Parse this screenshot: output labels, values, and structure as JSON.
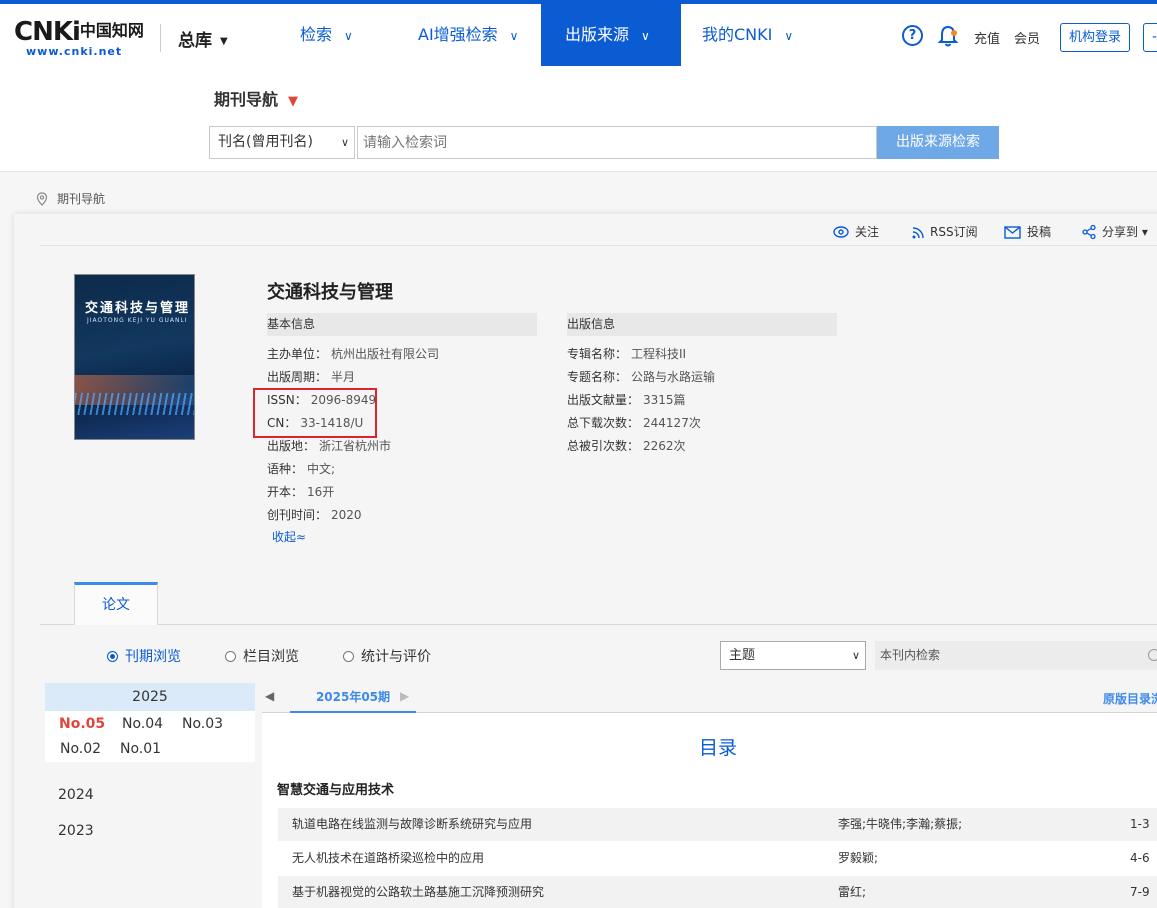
{
  "colors": {
    "brand": "#0b5bd3",
    "accent_red": "#e0473b",
    "search_btn": "#6fa8e6",
    "highlight_box": "#d9252b"
  },
  "header": {
    "logo_text": "CNKi",
    "logo_cn": "中国知网",
    "logo_url_text": "www.cnki.net",
    "database_select": "总库",
    "nav": [
      {
        "label": "检索",
        "active": false
      },
      {
        "label": "AI增强检索",
        "active": false
      },
      {
        "label": "出版来源",
        "active": true
      },
      {
        "label": "我的CNKI",
        "active": false
      }
    ],
    "recharge": "充值",
    "member": "会员",
    "institution_login": "机构登录",
    "icons": [
      "help-icon",
      "bell-icon",
      "chevron-down-icon"
    ]
  },
  "search": {
    "section_title": "期刊导航",
    "field_select": "刊名(曾用刊名)",
    "placeholder": "请输入检索词",
    "button": "出版来源检索"
  },
  "breadcrumb": {
    "current": "期刊导航"
  },
  "toolbar": {
    "follow": "关注",
    "rss": "RSS订阅",
    "submit": "投稿",
    "share": "分享到"
  },
  "journal": {
    "title": "交通科技与管理",
    "cover": {
      "title": "交通科技与管理",
      "pinyin": "JIAOTONG KEJI YU GUANLI"
    },
    "basic": {
      "heading": "基本信息",
      "rows": [
        {
          "label": "主办单位：",
          "value": "杭州出版社有限公司"
        },
        {
          "label": "出版周期：",
          "value": "半月"
        },
        {
          "label": "ISSN：",
          "value": "2096-8949"
        },
        {
          "label": "CN：",
          "value": "33-1418/U"
        },
        {
          "label": "出版地：",
          "value": "浙江省杭州市"
        },
        {
          "label": "语种：",
          "value": "中文;"
        },
        {
          "label": "开本：",
          "value": "16开"
        },
        {
          "label": "创刊时间：",
          "value": "2020"
        }
      ],
      "collapse": "收起≈"
    },
    "publication": {
      "heading": "出版信息",
      "rows": [
        {
          "label": "专辑名称：",
          "value": "工程科技II"
        },
        {
          "label": "专题名称：",
          "value": "公路与水路运输"
        },
        {
          "label": "出版文献量：",
          "value": "3315篇"
        },
        {
          "label": "总下载次数：",
          "value": "244127次"
        },
        {
          "label": "总被引次数：",
          "value": "2262次"
        }
      ]
    }
  },
  "tabs": {
    "papers": "论文"
  },
  "browse": {
    "options": [
      {
        "label": "刊期浏览",
        "selected": true
      },
      {
        "label": "栏目浏览",
        "selected": false
      },
      {
        "label": "统计与评价",
        "selected": false
      }
    ],
    "topic_select": "主题",
    "inner_search_placeholder": "本刊内检索"
  },
  "years": {
    "current": "2025",
    "issues": [
      "No.05",
      "No.04",
      "No.03",
      "No.02",
      "No.01"
    ],
    "current_issue": "No.05",
    "others": [
      "2024",
      "2023"
    ]
  },
  "toc": {
    "current_issue_label": "2025年05期",
    "original_toc_link": "原版目录浏",
    "title": "目录",
    "column": "智慧交通与应用技术",
    "articles": [
      {
        "title": "轨道电路在线监测与故障诊断系统研究与应用",
        "authors": "李强;牛晓伟;李瀚;蔡振;",
        "pages": "1-3"
      },
      {
        "title": "无人机技术在道路桥梁巡检中的应用",
        "authors": "罗毅颖;",
        "pages": "4-6"
      },
      {
        "title": "基于机器视觉的公路软土路基施工沉降预测研究",
        "authors": "雷红;",
        "pages": "7-9"
      }
    ]
  }
}
